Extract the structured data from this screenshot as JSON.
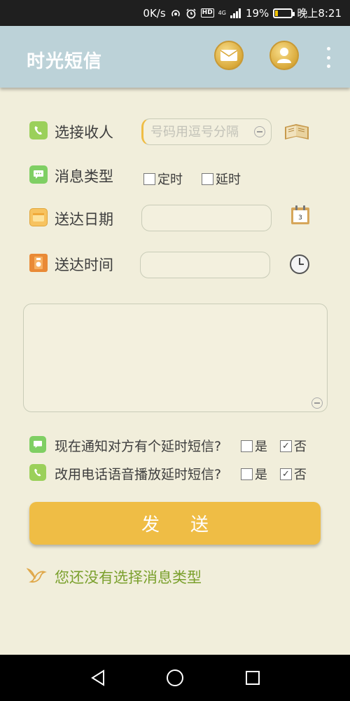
{
  "status_bar": {
    "speed": "0K/s",
    "network": "4G",
    "battery_pct": "19%",
    "battery_level": 0.19,
    "time": "晚上8:21"
  },
  "header": {
    "title": "时光短信",
    "bg_color": "#bcd2d8",
    "mail_icon": "mail-icon",
    "contact_icon": "contact-icon",
    "menu_icon": "more-vert-icon"
  },
  "form": {
    "recipient": {
      "label": "选接收人",
      "placeholder": "号码用逗号分隔",
      "value": "",
      "icon": "phone-icon",
      "action_icon": "address-book-icon"
    },
    "message_type": {
      "label": "消息类型",
      "icon": "chat-icon",
      "options": [
        {
          "label": "定时",
          "checked": false
        },
        {
          "label": "延时",
          "checked": false
        }
      ]
    },
    "date": {
      "label": "送达日期",
      "value": "",
      "icon": "date-folder-icon",
      "action_icon": "calendar-icon",
      "calendar_day": "3"
    },
    "time": {
      "label": "送达时间",
      "value": "",
      "icon": "time-icon",
      "action_icon": "clock-icon"
    },
    "message_body": {
      "value": ""
    }
  },
  "questions": [
    {
      "text": "现在通知对方有个延时短信?",
      "icon": "chat-icon",
      "yes_label": "是",
      "no_label": "否",
      "yes_checked": false,
      "no_checked": true
    },
    {
      "text": "改用电话语音播放延时短信?",
      "icon": "phone-icon",
      "yes_label": "是",
      "no_label": "否",
      "yes_checked": false,
      "no_checked": true
    }
  ],
  "send_button": {
    "label": "发送",
    "color": "#efbd45"
  },
  "status_message": {
    "text": "您还没有选择消息类型",
    "color": "#7aa02c",
    "icon": "bird-icon"
  },
  "nav_bar": {
    "back_icon": "back-triangle-icon",
    "home_icon": "home-circle-icon",
    "recents_icon": "recents-square-icon"
  }
}
